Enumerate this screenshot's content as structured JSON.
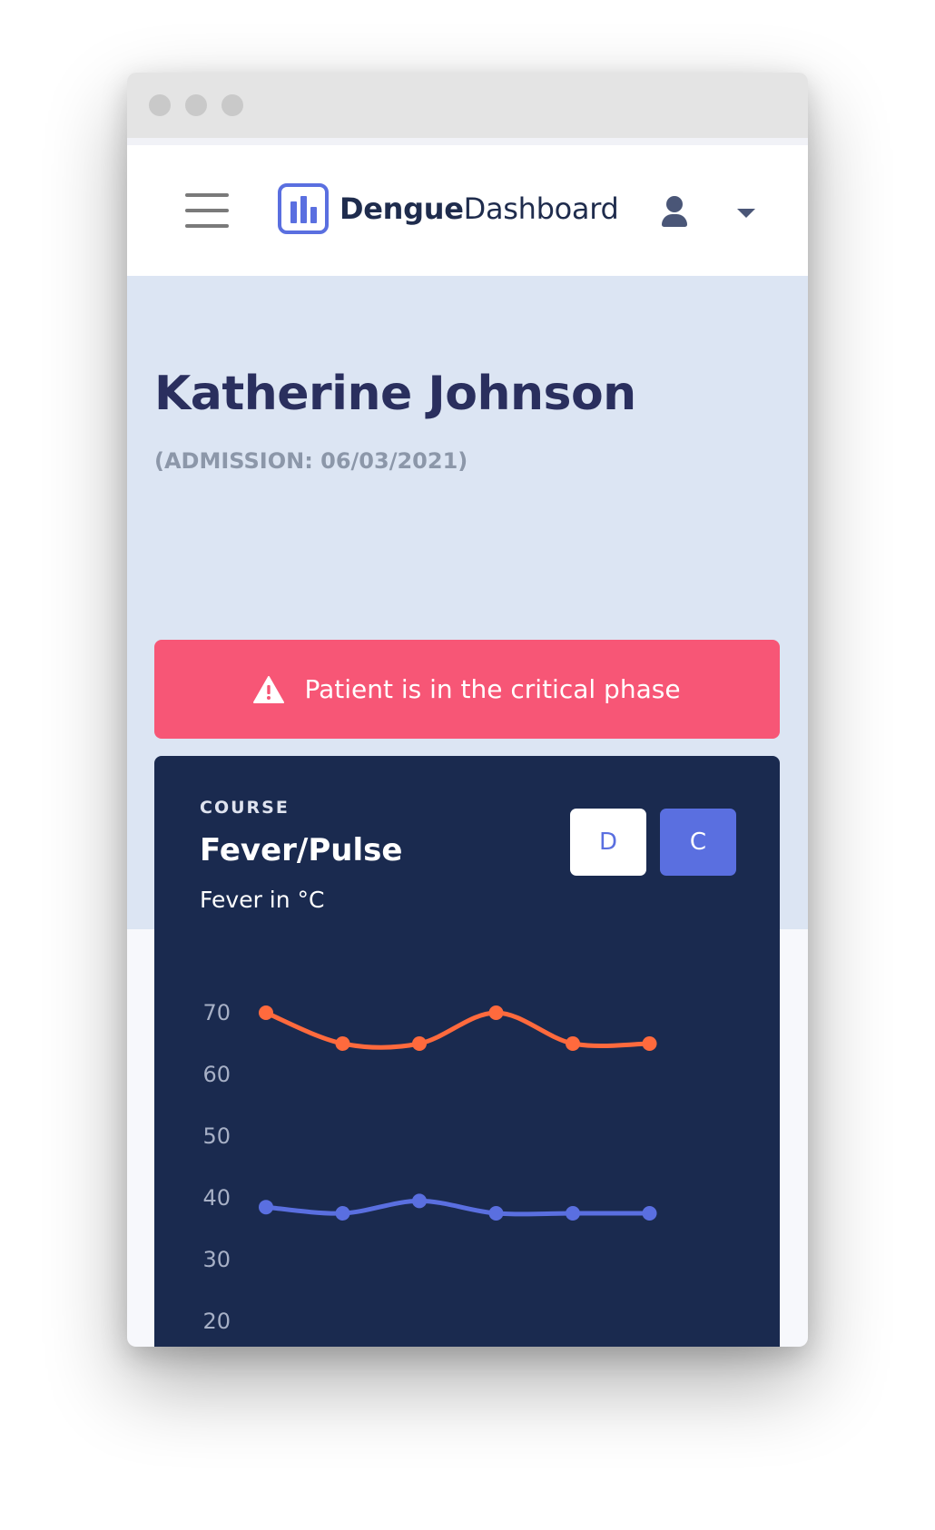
{
  "brand": {
    "bold": "Dengue",
    "regular": "Dashboard"
  },
  "icons": {
    "menu": "hamburger-icon",
    "logo": "bar-chart-icon",
    "user": "user-icon",
    "caret": "caret-down-icon",
    "warning": "warning-triangle-icon"
  },
  "patient": {
    "name": "Katherine Johnson",
    "admission": "(ADMISSION: 06/03/2021)"
  },
  "alert": {
    "text": "Patient is in the critical phase",
    "color": "#f75676"
  },
  "card": {
    "overline": "COURSE",
    "title": "Fever/Pulse",
    "subtitle": "Fever in °C",
    "toggle_d": "D",
    "toggle_c": "C",
    "active_toggle": "C"
  },
  "chart_data": {
    "type": "line",
    "yticks": [
      70,
      60,
      50,
      40,
      30,
      20
    ],
    "ylim": [
      20,
      70
    ],
    "grid": false,
    "x": [
      1,
      2,
      3,
      4,
      5,
      6
    ],
    "series": [
      {
        "values": [
          70,
          65,
          65,
          70,
          65,
          65
        ],
        "color": "#ff6a3d"
      },
      {
        "values": [
          38.5,
          37.5,
          39.5,
          37.5,
          37.5,
          37.5
        ],
        "color": "#5a6fe0"
      }
    ]
  },
  "colors": {
    "accent": "#5a6fe0",
    "navy": "#1a2a4f",
    "hero": "#dce5f3"
  }
}
